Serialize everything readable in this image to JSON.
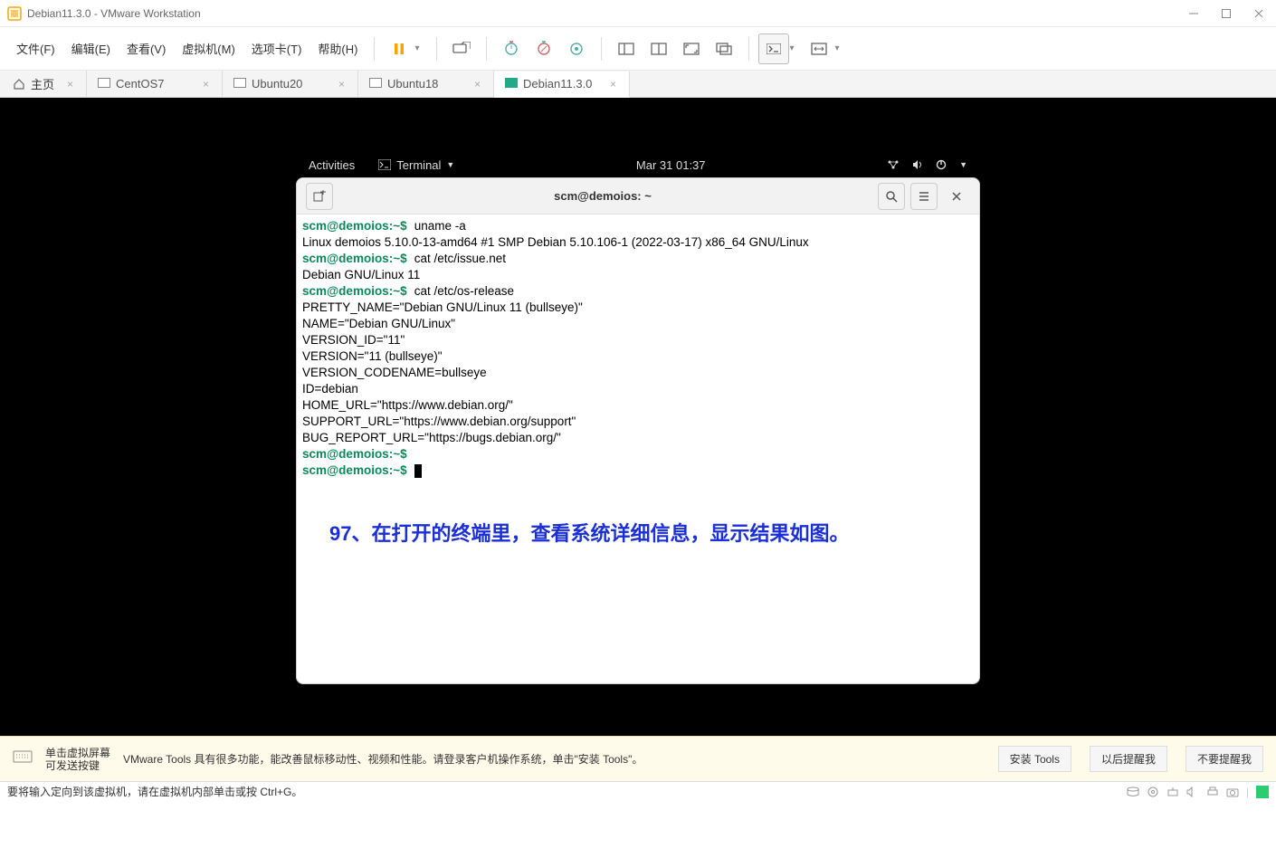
{
  "window": {
    "title": "Debian11.3.0 - VMware Workstation"
  },
  "menu": {
    "file": "文件(F)",
    "edit": "编辑(E)",
    "view": "查看(V)",
    "vm": "虚拟机(M)",
    "tabs": "选项卡(T)",
    "help": "帮助(H)"
  },
  "tabs": {
    "home": "主页",
    "items": [
      {
        "label": "CentOS7",
        "active": false
      },
      {
        "label": "Ubuntu20",
        "active": false
      },
      {
        "label": "Ubuntu18",
        "active": false
      },
      {
        "label": "Debian11.3.0",
        "active": true
      }
    ]
  },
  "gnome": {
    "activities": "Activities",
    "app": "Terminal",
    "clock": "Mar 31  01:37"
  },
  "terminal": {
    "title": "scm@demoios: ~",
    "prompt_user": "scm@demoios",
    "prompt_path": "~",
    "lines": {
      "cmd1": "uname -a",
      "out1": "Linux demoios 5.10.0-13-amd64 #1 SMP Debian 5.10.106-1 (2022-03-17) x86_64 GNU/Linux",
      "cmd2": "cat /etc/issue.net",
      "out2": "Debian GNU/Linux 11",
      "cmd3": "cat /etc/os-release",
      "out3a": "PRETTY_NAME=\"Debian GNU/Linux 11 (bullseye)\"",
      "out3b": "NAME=\"Debian GNU/Linux\"",
      "out3c": "VERSION_ID=\"11\"",
      "out3d": "VERSION=\"11 (bullseye)\"",
      "out3e": "VERSION_CODENAME=bullseye",
      "out3f": "ID=debian",
      "out3g": "HOME_URL=\"https://www.debian.org/\"",
      "out3h": "SUPPORT_URL=\"https://www.debian.org/support\"",
      "out3i": "BUG_REPORT_URL=\"https://bugs.debian.org/\""
    }
  },
  "caption": {
    "num": "97",
    "text": "、在打开的终端里，查看系统详细信息，显示结果如图。"
  },
  "infobar": {
    "hint1a": "单击虚拟屏幕",
    "hint1b": "可发送按键",
    "hint2": "VMware Tools 具有很多功能，能改善鼠标移动性、视频和性能。请登录客户机操作系统，单击\"安装 Tools\"。",
    "btn1": "安装 Tools",
    "btn2": "以后提醒我",
    "btn3": "不要提醒我"
  },
  "statusbar": {
    "msg": "要将输入定向到该虚拟机，请在虚拟机内部单击或按 Ctrl+G。"
  }
}
